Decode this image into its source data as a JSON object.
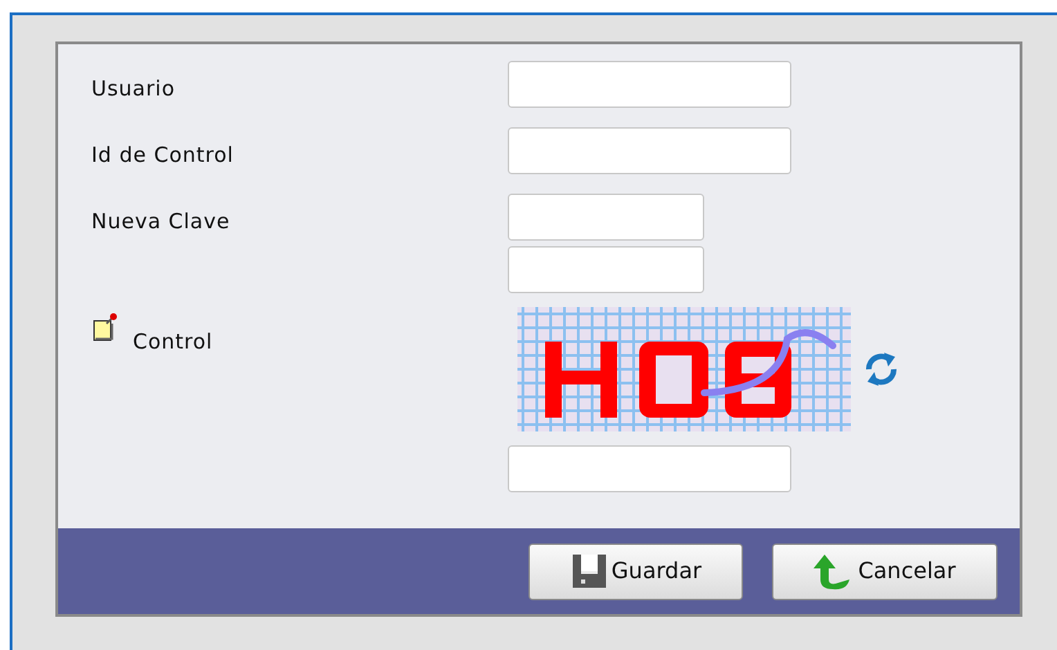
{
  "form": {
    "fields": [
      {
        "label": "Usuario",
        "kind": "text"
      },
      {
        "label": "Id de Control",
        "kind": "text"
      },
      {
        "label": "Nueva Clave",
        "kind": "password"
      },
      {
        "label": "Control",
        "kind": "captcha"
      }
    ]
  },
  "buttons": [
    {
      "label": "Guardar",
      "kind": "save"
    },
    {
      "label": "Cancelar",
      "kind": "cancel"
    }
  ]
}
